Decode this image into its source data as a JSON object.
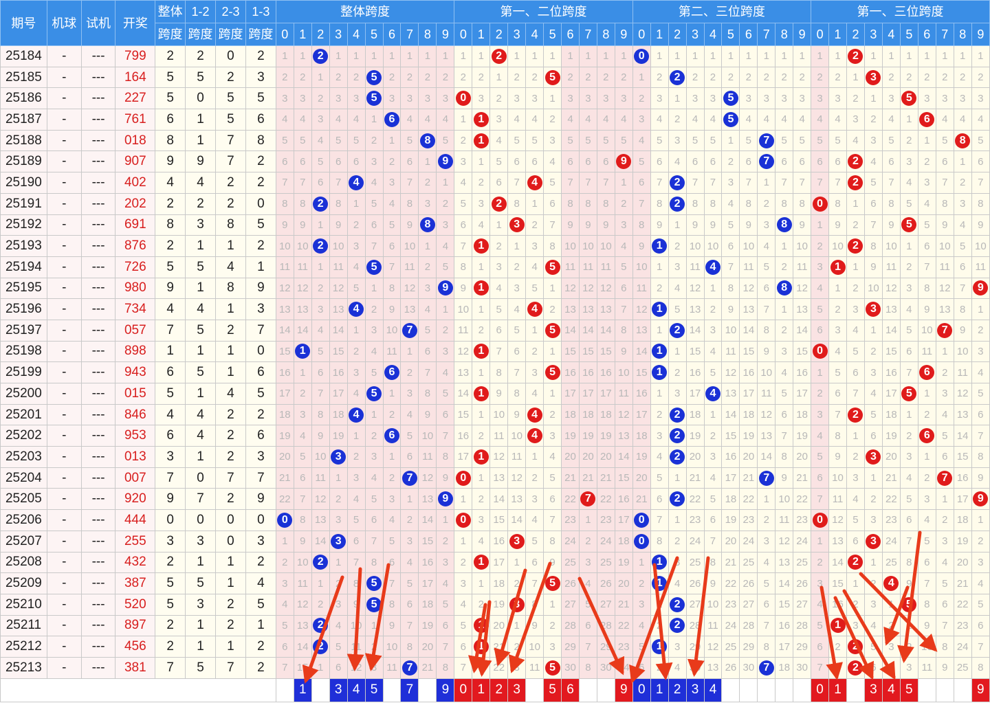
{
  "headers": {
    "issue": "期号",
    "machine": "机球",
    "trial": "试机",
    "draw": "开奖",
    "span_total": [
      "整体",
      "跨度"
    ],
    "span12": [
      "1-2",
      "跨度"
    ],
    "span23": [
      "2-3",
      "跨度"
    ],
    "span13": [
      "1-3",
      "跨度"
    ],
    "groups": [
      "整体跨度",
      "第一、二位跨度",
      "第二、三位跨度",
      "第一、三位跨度"
    ],
    "digits": [
      "0",
      "1",
      "2",
      "3",
      "4",
      "5",
      "6",
      "7",
      "8",
      "9"
    ]
  },
  "colors": {
    "header_bg": "#3a8ee6",
    "blue_ball": "#1a31d6",
    "red_ball": "#e01b1b",
    "arrow": "#e83a1a"
  },
  "rows": [
    {
      "issue": "25184",
      "machine": "-",
      "trial": "---",
      "draw": "799",
      "s": [
        2,
        2,
        0,
        2
      ],
      "g": [
        "1 1 *2 1 1 1 1 1 1 1",
        "1 1 *2 1 1 1 1 1 1 1",
        "*0 1 1 1 1 1 1 1 1 1",
        "1 1 *2 1 1 1 1 1 1 1"
      ]
    },
    {
      "issue": "25185",
      "machine": "-",
      "trial": "---",
      "draw": "164",
      "s": [
        5,
        5,
        2,
        3
      ],
      "g": [
        "2 2 1 2 2 *5 2 2 2 2",
        "2 2 1 2 2 *5 2 2 2 2",
        "1 2 *2 2 2 2 2 2 2 2",
        "2 2 1 *3 2 2 2 2 2 2"
      ]
    },
    {
      "issue": "25186",
      "machine": "-",
      "trial": "---",
      "draw": "227",
      "s": [
        5,
        0,
        5,
        5
      ],
      "g": [
        "3 3 2 3 3 *5 3 3 3 3",
        "*0 3 2 3 3 1 3 3 3 3",
        "2 3 1 3 3 *5 3 3 3 3",
        "3 3 2 1 3 *5 3 3 3 3"
      ]
    },
    {
      "issue": "25187",
      "machine": "-",
      "trial": "---",
      "draw": "761",
      "s": [
        6,
        1,
        5,
        6
      ],
      "g": [
        "4 4 3 4 4 1 *6 4 4 4",
        "1 *1 3 4 4 2 4 4 4 4",
        "3 4 2 4 4 *5 4 4 4 4",
        "4 4 3 2 4 1 *6 4 4 4"
      ]
    },
    {
      "issue": "25188",
      "machine": "-",
      "trial": "---",
      "draw": "018",
      "s": [
        8,
        1,
        7,
        8
      ],
      "g": [
        "5 5 4 5 5 2 1 5 *8 5",
        "2 *1 4 5 5 3 5 5 5 5",
        "4 5 3 5 5 1 5 *7 5 5",
        "5 5 4 3 5 2 1 5 *8 5"
      ]
    },
    {
      "issue": "25189",
      "machine": "-",
      "trial": "---",
      "draw": "907",
      "s": [
        9,
        9,
        7,
        2
      ],
      "g": [
        "6 6 5 6 6 3 2 6 1 *9",
        "3 1 5 6 6 4 6 6 6 *9",
        "5 6 4 6 6 2 6 *7 6 6",
        "6 6 *2 4 6 3 2 6 1 6"
      ]
    },
    {
      "issue": "25190",
      "machine": "-",
      "trial": "---",
      "draw": "402",
      "s": [
        4,
        4,
        2,
        2
      ],
      "g": [
        "7 7 6 7 *4 4 3 7 2 1",
        "4 2 6 7 *4 5 7 7 7 1",
        "6 7 *2 7 7 3 7 1 7 7",
        "7 7 *2 5 7 4 3 7 2 7"
      ]
    },
    {
      "issue": "25191",
      "machine": "-",
      "trial": "---",
      "draw": "202",
      "s": [
        2,
        2,
        2,
        0
      ],
      "g": [
        "8 8 *2 8 1 5 4 8 3 2",
        "5 3 *2 8 1 6 8 8 8 2",
        "7 8 *2 8 8 4 8 2 8 8",
        "*0 8 1 6 8 5 4 8 3 8"
      ]
    },
    {
      "issue": "25192",
      "machine": "-",
      "trial": "---",
      "draw": "691",
      "s": [
        8,
        3,
        8,
        5
      ],
      "g": [
        "9 9 1 9 2 6 5 9 *8 3",
        "6 4 1 *3 2 7 9 9 9 3",
        "8 9 1 9 9 5 9 3 *8 9",
        "1 9 2 7 9 *5 5 9 4 9"
      ]
    },
    {
      "issue": "25193",
      "machine": "-",
      "trial": "---",
      "draw": "876",
      "s": [
        2,
        1,
        1,
        2
      ],
      "g": [
        "10 10 *2 10 3 7 6 10 1 4",
        "7 *1 2 1 3 8 10 10 10 4",
        "9 *1 2 10 10 6 10 4 1 10",
        "2 10 *2 8 10 1 6 10 5 10"
      ]
    },
    {
      "issue": "25194",
      "machine": "-",
      "trial": "---",
      "draw": "726",
      "s": [
        5,
        5,
        4,
        1
      ],
      "g": [
        "11 11 1 11 4 *5 7 11 2 5",
        "8 1 3 2 4 *5 11 11 11 5",
        "10 1 3 11 *4 7 11 5 2 11",
        "3 *1 1 9 11 2 7 11 6 11"
      ]
    },
    {
      "issue": "25195",
      "machine": "-",
      "trial": "---",
      "draw": "980",
      "s": [
        9,
        1,
        8,
        9
      ],
      "g": [
        "12 12 2 12 5 1 8 12 3 *9",
        "9 *1 4 3 5 1 12 12 12 6",
        "11 2 4 12 1 8 12 6 *8 12",
        "4 1 2 10 12 3 8 12 7 *9"
      ]
    },
    {
      "issue": "25196",
      "machine": "-",
      "trial": "---",
      "draw": "734",
      "s": [
        4,
        4,
        1,
        3
      ],
      "g": [
        "13 13 3 13 *4 2 9 13 4 1",
        "10 1 5 4 *4 2 13 13 13 7",
        "12 *1 5 13 2 9 13 7 1 13",
        "5 2 3 *3 13 4 9 13 8 1"
      ]
    },
    {
      "issue": "25197",
      "machine": "-",
      "trial": "---",
      "draw": "057",
      "s": [
        7,
        5,
        2,
        7
      ],
      "g": [
        "14 14 4 14 1 3 10 *7 5 2",
        "11 2 6 5 1 *5 14 14 14 8",
        "13 1 *2 14 3 10 14 8 2 14",
        "6 3 4 1 14 5 10 *7 9 2"
      ]
    },
    {
      "issue": "25198",
      "machine": "-",
      "trial": "---",
      "draw": "898",
      "s": [
        1,
        1,
        1,
        0
      ],
      "g": [
        "15 *1 5 15 2 4 11 1 6 3",
        "12 *1 7 6 2 1 15 15 15 9",
        "14 *1 1 15 4 11 15 9 3 15",
        "*0 4 5 2 15 6 11 1 10 3"
      ]
    },
    {
      "issue": "25199",
      "machine": "-",
      "trial": "---",
      "draw": "943",
      "s": [
        6,
        5,
        1,
        6
      ],
      "g": [
        "16 1 6 16 3 5 *6 2 7 4",
        "13 1 8 7 3 *5 16 16 16 10",
        "15 *1 2 16 5 12 16 10 4 16",
        "1 5 6 3 16 7 *6 2 11 4"
      ]
    },
    {
      "issue": "25200",
      "machine": "-",
      "trial": "---",
      "draw": "015",
      "s": [
        5,
        1,
        4,
        5
      ],
      "g": [
        "17 2 7 17 4 *5 1 3 8 5",
        "14 *1 9 8 4 1 17 17 17 11",
        "16 1 3 17 *4 13 17 11 5 17",
        "2 6 7 4 17 *5 1 3 12 5"
      ]
    },
    {
      "issue": "25201",
      "machine": "-",
      "trial": "---",
      "draw": "846",
      "s": [
        4,
        4,
        2,
        2
      ],
      "g": [
        "18 3 8 18 *4 1 2 4 9 6",
        "15 1 10 9 *4 2 18 18 18 12",
        "17 2 *2 18 1 14 18 12 6 18",
        "3 7 *2 5 18 1 2 4 13 6"
      ]
    },
    {
      "issue": "25202",
      "machine": "-",
      "trial": "---",
      "draw": "953",
      "s": [
        6,
        4,
        2,
        6
      ],
      "g": [
        "19 4 9 19 1 2 *6 5 10 7",
        "16 2 11 10 *4 3 19 19 19 13",
        "18 3 *2 19 2 15 19 13 7 19",
        "4 8 1 6 19 2 *6 5 14 7"
      ]
    },
    {
      "issue": "25203",
      "machine": "-",
      "trial": "---",
      "draw": "013",
      "s": [
        3,
        1,
        2,
        3
      ],
      "g": [
        "20 5 10 *3 2 3 1 6 11 8",
        "17 *1 12 11 1 4 20 20 20 14",
        "19 4 *2 20 3 16 20 14 8 20",
        "5 9 2 *3 20 3 1 6 15 8"
      ]
    },
    {
      "issue": "25204",
      "machine": "-",
      "trial": "---",
      "draw": "007",
      "s": [
        7,
        0,
        7,
        7
      ],
      "g": [
        "21 6 11 1 3 4 2 *7 12 9",
        "*0 1 13 12 2 5 21 21 21 15",
        "20 5 1 21 4 17 21 *7 9 21",
        "6 10 3 1 21 4 2 *7 16 9"
      ]
    },
    {
      "issue": "25205",
      "machine": "-",
      "trial": "---",
      "draw": "920",
      "s": [
        9,
        7,
        2,
        9
      ],
      "g": [
        "22 7 12 2 4 5 3 1 13 *9",
        "1 2 14 13 3 6 22 *7 22 16",
        "21 6 *2 22 5 18 22 1 10 22",
        "7 11 4 2 22 5 3 1 17 *9"
      ]
    },
    {
      "issue": "25206",
      "machine": "-",
      "trial": "---",
      "draw": "444",
      "s": [
        0,
        0,
        0,
        0
      ],
      "g": [
        "*0 8 13 3 5 6 4 2 14 1",
        "*0 3 15 14 4 7 23 1 23 17",
        "*0 7 1 23 6 19 23 2 11 23",
        "*0 12 5 3 23 6 4 2 18 1"
      ]
    },
    {
      "issue": "25207",
      "machine": "-",
      "trial": "---",
      "draw": "255",
      "s": [
        3,
        3,
        0,
        3
      ],
      "g": [
        "1 9 14 *3 6 7 5 3 15 2",
        "1 4 16 *3 5 8 24 2 24 18",
        "*0 8 2 24 7 20 24 3 12 24",
        "1 13 6 *3 24 7 5 3 19 2"
      ]
    },
    {
      "issue": "25208",
      "machine": "-",
      "trial": "---",
      "draw": "432",
      "s": [
        2,
        1,
        1,
        2
      ],
      "g": [
        "2 10 *2 1 7 8 6 4 16 3",
        "2 *1 17 1 6 9 25 3 25 19",
        "1 *1 3 25 8 21 25 4 13 25",
        "2 14 *2 1 25 8 6 4 20 3"
      ]
    },
    {
      "issue": "25209",
      "machine": "-",
      "trial": "---",
      "draw": "387",
      "s": [
        5,
        5,
        1,
        4
      ],
      "g": [
        "3 11 1 2 8 *5 7 5 17 4",
        "3 1 18 2 7 *5 26 4 26 20",
        "2 *1 4 26 9 22 26 5 14 26",
        "3 15 1 2 *4 9 7 5 21 4"
      ]
    },
    {
      "issue": "25210",
      "machine": "-",
      "trial": "---",
      "draw": "520",
      "s": [
        5,
        3,
        2,
        5
      ],
      "g": [
        "4 12 2 3 9 *5 8 6 18 5",
        "4 2 19 *3 8 1 27 5 27 21",
        "3 1 *2 27 10 23 27 6 15 27",
        "4 16 2 3 1 *5 8 6 22 5"
      ]
    },
    {
      "issue": "25211",
      "machine": "-",
      "trial": "---",
      "draw": "897",
      "s": [
        2,
        1,
        2,
        1
      ],
      "g": [
        "5 13 *2 4 10 1 9 7 19 6",
        "5 *1 20 1 9 2 28 6 28 22",
        "4 2 *2 28 11 24 28 7 16 28",
        "5 *1 3 4 2 1 9 7 23 6"
      ]
    },
    {
      "issue": "25212",
      "machine": "-",
      "trial": "---",
      "draw": "456",
      "s": [
        2,
        1,
        1,
        2
      ],
      "g": [
        "6 14 *2 5 11 2 10 8 20 7",
        "6 *1 21 2 10 3 29 7 29 23",
        "5 *1 3 29 12 25 29 8 17 29",
        "6 2 *2 5 3 2 10 8 24 7"
      ]
    },
    {
      "issue": "25213",
      "machine": "-",
      "trial": "---",
      "draw": "381",
      "s": [
        7,
        5,
        7,
        2
      ],
      "g": [
        "7 15 1 6 12 3 11 *7 21 8",
        "7 1 22 3 11 *5 30 8 30 24",
        "6 2 4 30 13 26 30 *7 18 30",
        "7 3 *2 6 4 3 11 9 25 8"
      ]
    }
  ],
  "stat": [
    [
      "",
      "1",
      "",
      "3",
      "4",
      "5",
      "",
      "7",
      "",
      "9"
    ],
    [
      "0",
      "1",
      "2",
      "3",
      "",
      "5",
      "6",
      "",
      "",
      "9"
    ],
    [
      "0",
      "1",
      "2",
      "3",
      "4",
      "",
      "",
      "",
      "",
      ""
    ],
    [
      "0",
      "1",
      "",
      "3",
      "4",
      "5",
      "",
      "",
      "",
      "9"
    ]
  ]
}
